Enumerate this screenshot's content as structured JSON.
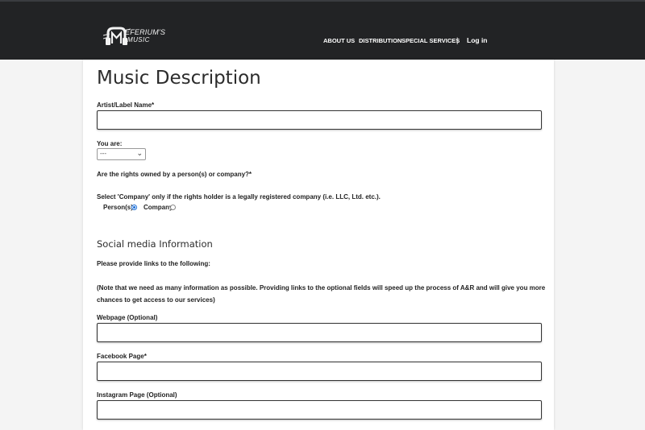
{
  "header": {
    "logo": {
      "line1": "EFERIUM'S",
      "line2": "MUSIC"
    },
    "nav": [
      {
        "label": "ABOUT US"
      },
      {
        "label": "DISTRIBUTION"
      },
      {
        "label": "SPECIAL SERVICES"
      }
    ],
    "separator": "|",
    "login_label": "Log in"
  },
  "form": {
    "title": "Music Description",
    "artist_label": "Artist/Label Name*",
    "artist_value": "",
    "you_are_label": "You are:",
    "you_are_selected": "---",
    "rights_question": "Are the rights owned by a person(s) or company?*",
    "rights_hint": "Select 'Company' only if the rights holder is a legally registered company (i.e. LLC, Ltd. etc.).",
    "rights_options": [
      {
        "label": "Person(s)",
        "checked": true
      },
      {
        "label": "Company",
        "checked": false
      }
    ],
    "social_title": "Social media Information",
    "social_intro": "Please provide links to the following:",
    "social_note": "(Note that we need as many information as possible. Providing links to the optional fields will speed up the process of A&R and will give you more chances to get access to our services)",
    "webpage_label": "Webpage (Optional)",
    "webpage_value": "",
    "facebook_label": "Facebook Page*",
    "facebook_value": "",
    "instagram_label": "Instagram Page (Optional)",
    "instagram_value": ""
  },
  "colors": {
    "header_bg": "#222325",
    "page_bg": "#f4f4f4",
    "radio_accent": "#1a6ed8"
  },
  "icons": {
    "logo": "headphones-m-logo-icon",
    "select": "chevron-down-icon"
  }
}
